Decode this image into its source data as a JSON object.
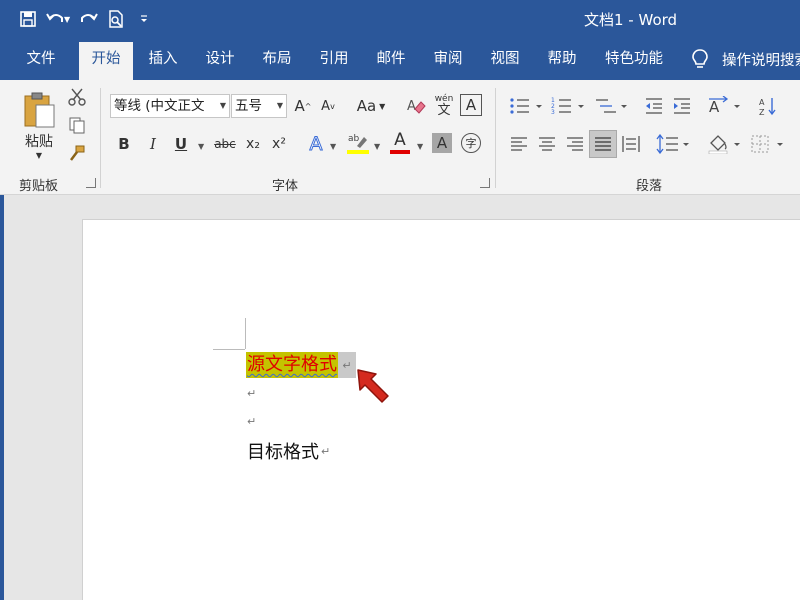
{
  "window": {
    "title": "文档1 - Word"
  },
  "tabs": [
    "文件",
    "开始",
    "插入",
    "设计",
    "布局",
    "引用",
    "邮件",
    "审阅",
    "视图",
    "帮助",
    "特色功能"
  ],
  "active_tab": "开始",
  "tell_me": "操作说明搜索",
  "ribbon": {
    "clipboard": {
      "label": "剪贴板",
      "paste_label": "粘贴"
    },
    "font": {
      "label": "字体",
      "font_name": "等线 (中文正文",
      "font_size": "五号",
      "aa_label": "Aa",
      "bold": "B",
      "italic": "I",
      "underline": "U",
      "strike": "abc",
      "sub": "x₂",
      "sup": "x²",
      "wen_top": "wén",
      "wen_bottom": "文",
      "char_border": "A",
      "enclose": "字",
      "shade_a": "A",
      "font_color_a": "A",
      "effect_a": "A",
      "grow_a": "A",
      "shrink_a": "A",
      "font_color_hex": "#e00000",
      "highlight_hex": "#ffff00"
    },
    "paragraph": {
      "label": "段落"
    }
  },
  "document": {
    "source_text": "源文字格式",
    "target_text": "目标格式",
    "paragraph_mark": "↵",
    "source_highlight_hex": "#c4c300",
    "source_color_hex": "#e00000"
  }
}
